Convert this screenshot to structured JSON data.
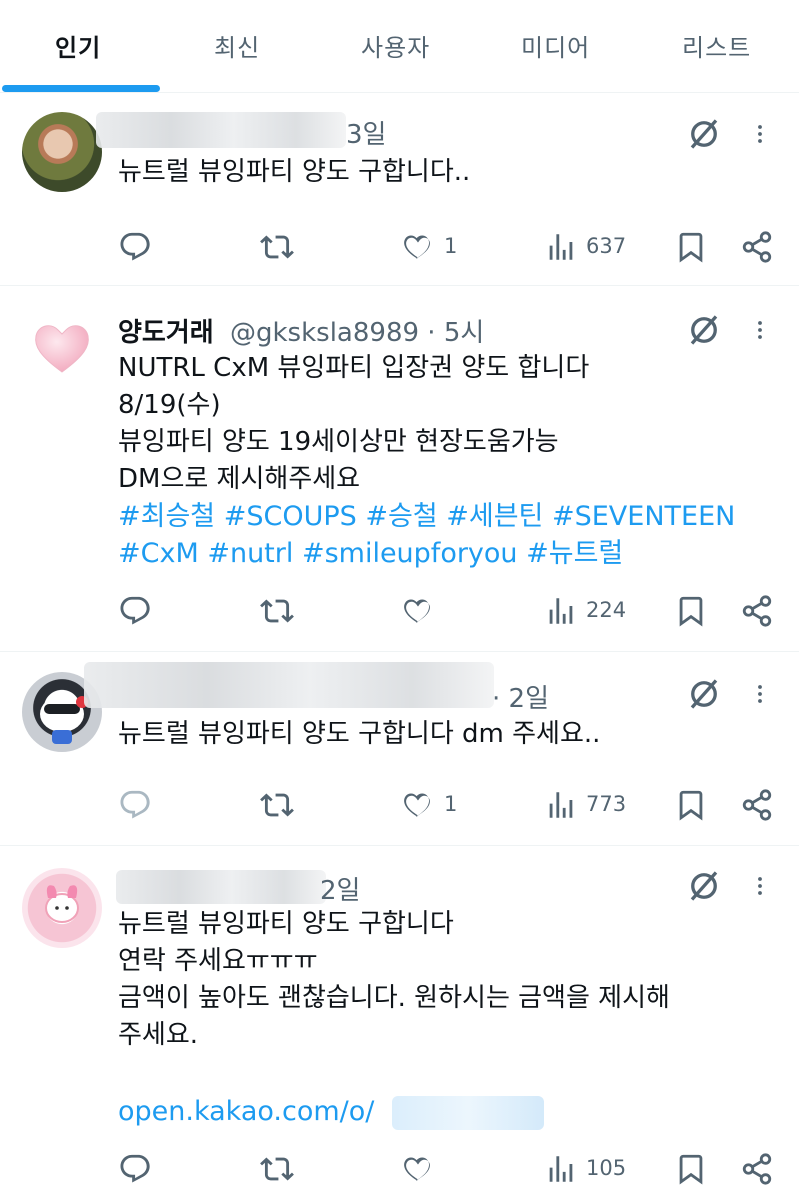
{
  "tabs": [
    {
      "label": "인기"
    },
    {
      "label": "최신"
    },
    {
      "label": "사용자"
    },
    {
      "label": "미디어"
    },
    {
      "label": "리스트"
    }
  ],
  "tweets": [
    {
      "name": "",
      "handle_time": "3일",
      "text": "뉴트럴 뷰잉파티 양도 구합니다..",
      "likes": "1",
      "views": "637"
    },
    {
      "name": "양도거래",
      "handle_time": "@gksksla8989 · 5시",
      "text": "NUTRL CxM 뷰잉파티 입장권 양도 합니다\n8/19(수)\n뷰잉파티 양도 19세이상만 현장도움가능\nDM으로 제시해주세요",
      "hashtags_line1": "#최승철 #SCOUPS #승철 #세븐틴 #SEVENTEEN",
      "hashtags_line2": "#CxM #nutrl #smileupforyou #뉴트럴",
      "likes": "",
      "views": "224"
    },
    {
      "name": "",
      "handle_time": "· 2일",
      "text": "뉴트럴 뷰잉파티 양도 구합니다 dm 주세요..",
      "likes": "1",
      "views": "773"
    },
    {
      "name": "",
      "handle_time": "2일",
      "text": "뉴트럴 뷰잉파티 양도 구합니다\n연락 주세요ㅠㅠㅠ\n금액이 높아도 괜찮습니다. 원하시는 금액을 제시해\n주세요.",
      "link": "open.kakao.com/o/",
      "likes": "",
      "views": "105"
    }
  ],
  "colors": {
    "accent": "#1d9bf0",
    "text": "#0f1419",
    "muted": "#536471",
    "divider": "#eff3f4"
  },
  "icons": [
    "reply-icon",
    "retweet-icon",
    "like-icon",
    "views-icon",
    "bookmark-icon",
    "share-icon",
    "grok-icon",
    "more-icon"
  ]
}
